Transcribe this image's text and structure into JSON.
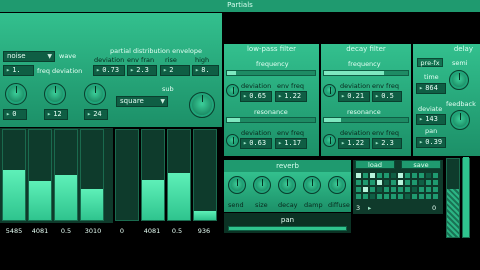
{
  "title": "Partials",
  "wave": {
    "label": "wave",
    "selected": "noise",
    "freq_deviation_label": "freq deviation",
    "freq_deviation_value": "1.",
    "knob_values": [
      "0",
      "12",
      "24"
    ]
  },
  "partial_envelope": {
    "title": "partial distribution envelope",
    "columns": [
      "deviation",
      "env fran",
      "rise",
      "high"
    ],
    "values": [
      "0.73",
      "2.3",
      "2",
      "8."
    ]
  },
  "sub": {
    "label": "sub",
    "selected": "square"
  },
  "multislider_left": {
    "values": [
      0.56,
      0.43,
      0.5,
      0.35
    ],
    "labels": [
      "5485",
      "4081",
      "0.5",
      "3010"
    ]
  },
  "multislider_right": {
    "values": [
      0.0,
      0.44,
      0.52,
      0.1
    ],
    "labels": [
      "0",
      "4081",
      "0.5",
      "936"
    ]
  },
  "lowpass": {
    "title": "low-pass filter",
    "frequency_label": "frequency",
    "frequency_level": 0.1,
    "dev_label": "deviation",
    "envfreq_label": "env freq",
    "dev1": "0.65",
    "envfreq1": "1.22",
    "resonance_label": "resonance",
    "resonance_level": 0.15,
    "dev2": "0.63",
    "envfreq2": "1.17"
  },
  "decay": {
    "title": "decay filter",
    "frequency_label": "frequency",
    "frequency_level": 0.72,
    "dev_label": "deviation",
    "envfreq_label": "env freq",
    "dev1": "0.21",
    "envfreq1": "0.5",
    "resonance_label": "resonance",
    "resonance_level": 0.2,
    "dev2": "1.22",
    "envfreq2": "2.3"
  },
  "delay": {
    "title": "delay",
    "prefx": "pre-fx",
    "semi_label": "semi",
    "time_label": "time",
    "time_value": "864",
    "feedback_label": "feedback",
    "deviate_label": "deviate",
    "deviate_value": "143",
    "pan_label": "pan",
    "pan_value": "0.39"
  },
  "reverb": {
    "title": "reverb",
    "knobs": [
      "send",
      "size",
      "decay",
      "damp",
      "diffuse"
    ],
    "pan_label": "pan"
  },
  "presets": {
    "load": "load",
    "save": "save",
    "left_number": "3",
    "right_number": "0"
  },
  "colors": {
    "panel": "#2bb584",
    "accent": "#7ee8c0",
    "dark": "#0f5e44"
  }
}
